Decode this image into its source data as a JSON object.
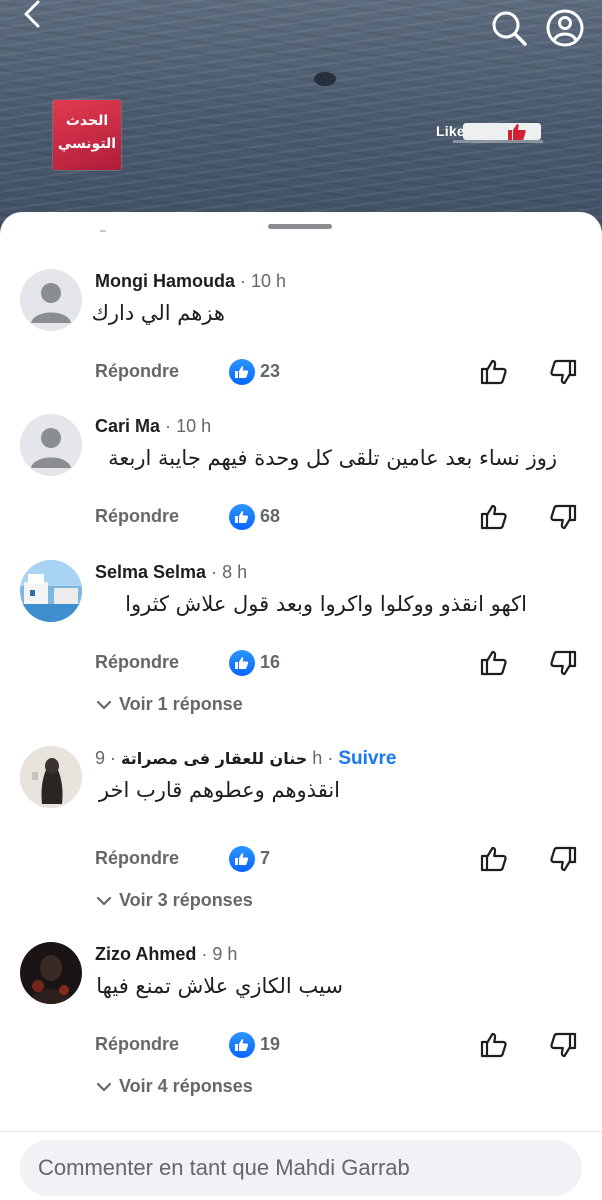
{
  "video": {
    "logo_line1": "الحدث",
    "logo_line2": "التونسي",
    "like_badge_text": "Like"
  },
  "comments": [
    {
      "author": "Mongi Hamouda",
      "time": "10 h",
      "text": "هزهم الي دارك",
      "reply_label": "Répondre",
      "likes": "23"
    },
    {
      "author": "Cari Ma",
      "time": "10 h",
      "text": "زوز نساء بعد عامين تلقى كل وحدة فيهم جايبة اربعة",
      "reply_label": "Répondre",
      "likes": "68"
    },
    {
      "author": "Selma Selma",
      "time": "8 h",
      "text": "اكهو انقذو ووكلوا واكروا وبعد قول علاش كثروا",
      "reply_label": "Répondre",
      "likes": "16",
      "view_replies": "Voir 1 réponse"
    },
    {
      "author": "حنان للعقار فى مصراتة",
      "time": "9 h",
      "follow": "Suivre",
      "text": "انقذوهم وعطوهم قارب اخر",
      "reply_label": "Répondre",
      "likes": "7",
      "view_replies": "Voir 3 réponses"
    },
    {
      "author": "Zizo Ahmed",
      "time": "9 h",
      "text": "سيب الكازي علاش تمنع فيها",
      "reply_label": "Répondre",
      "likes": "19",
      "view_replies": "Voir 4 réponses"
    }
  ],
  "separator": "·",
  "composer": {
    "placeholder": "Commenter en tant que Mahdi Garrab"
  },
  "colors": {
    "accent": "#1877f2",
    "like_blue": "#0866ff",
    "muted": "#65676b"
  }
}
